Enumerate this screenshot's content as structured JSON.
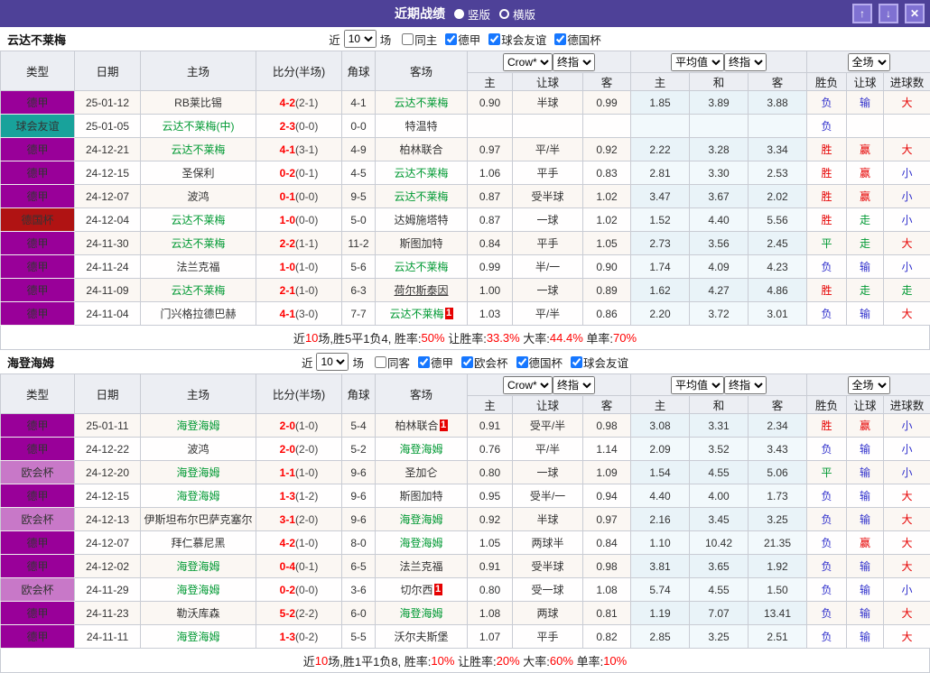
{
  "titlebar": {
    "title": "近期战绩",
    "vertical_label": "竖版",
    "horizontal_label": "横版",
    "vertical_selected": true,
    "buttons": {
      "up_icon": "↑",
      "down_icon": "↓",
      "close_icon": "✕"
    }
  },
  "labels": {
    "near": "近",
    "games": "场"
  },
  "selectors": {
    "odds_source": "Crow*",
    "final_odds": "终指",
    "average": "平均值",
    "final_odds2": "终指",
    "full_match": "全场"
  },
  "columns": {
    "type": "类型",
    "date": "日期",
    "home": "主场",
    "score": "比分(半场)",
    "corners": "角球",
    "away": "客场",
    "sub": [
      "主",
      "让球",
      "客",
      "主",
      "和",
      "客",
      "胜负",
      "让球",
      "进球数"
    ]
  },
  "colors": {
    "titlebar_bg": "#4e4198",
    "score_red": "#ff0000",
    "focus_team_green": "#009933",
    "result_red": "#e60000",
    "result_blue": "#3030cc",
    "result_green": "#009933",
    "badge_red": "#e60000",
    "type_colors": {
      "德甲": "#990099",
      "球会友谊": "#18a29b",
      "德国杯": "#b01313",
      "欧会杯": "#c878c8"
    },
    "result_map": {
      "胜": "red",
      "平": "green",
      "负": "blue",
      "赢": "red",
      "走": "green",
      "输": "blue",
      "大": "red",
      "小": "blue"
    }
  },
  "teams": [
    {
      "name": "云达不莱梅",
      "filter": {
        "count": "10",
        "same": {
          "label": "同主",
          "checked": false
        },
        "competitions": [
          {
            "label": "德甲",
            "checked": true
          },
          {
            "label": "球会友谊",
            "checked": true
          },
          {
            "label": "德国杯",
            "checked": true
          }
        ]
      },
      "rows": [
        {
          "type": "德甲",
          "date": "25-01-12",
          "home": "RB莱比锡",
          "score": "4-2",
          "half": "(2-1)",
          "corners": "4-1",
          "away": "云达不莱梅",
          "away_focus": true,
          "odds": [
            "0.90",
            "半球",
            "0.99"
          ],
          "avg": [
            "1.85",
            "3.89",
            "3.88"
          ],
          "results": [
            "负",
            "输",
            "大"
          ]
        },
        {
          "type": "球会友谊",
          "date": "25-01-05",
          "home": "云达不莱梅(中)",
          "home_focus": true,
          "score": "2-3",
          "half": "(0-0)",
          "corners": "0-0",
          "away": "特温特",
          "odds": [
            "",
            "",
            ""
          ],
          "avg": [
            "",
            "",
            ""
          ],
          "results": [
            "负",
            "",
            ""
          ]
        },
        {
          "type": "德甲",
          "date": "24-12-21",
          "home": "云达不莱梅",
          "home_focus": true,
          "score": "4-1",
          "half": "(3-1)",
          "corners": "4-9",
          "away": "柏林联合",
          "odds": [
            "0.97",
            "平/半",
            "0.92"
          ],
          "avg": [
            "2.22",
            "3.28",
            "3.34"
          ],
          "results": [
            "胜",
            "赢",
            "大"
          ]
        },
        {
          "type": "德甲",
          "date": "24-12-15",
          "home": "圣保利",
          "score": "0-2",
          "half": "(0-1)",
          "corners": "4-5",
          "away": "云达不莱梅",
          "away_focus": true,
          "odds": [
            "1.06",
            "平手",
            "0.83"
          ],
          "avg": [
            "2.81",
            "3.30",
            "2.53"
          ],
          "results": [
            "胜",
            "赢",
            "小"
          ]
        },
        {
          "type": "德甲",
          "date": "24-12-07",
          "home": "波鸿",
          "score": "0-1",
          "half": "(0-0)",
          "corners": "9-5",
          "away": "云达不莱梅",
          "away_focus": true,
          "odds": [
            "0.87",
            "受半球",
            "1.02"
          ],
          "avg": [
            "3.47",
            "3.67",
            "2.02"
          ],
          "results": [
            "胜",
            "赢",
            "小"
          ]
        },
        {
          "type": "德国杯",
          "date": "24-12-04",
          "home": "云达不莱梅",
          "home_focus": true,
          "score": "1-0",
          "half": "(0-0)",
          "corners": "5-0",
          "away": "达姆施塔特",
          "odds": [
            "0.87",
            "一球",
            "1.02"
          ],
          "avg": [
            "1.52",
            "4.40",
            "5.56"
          ],
          "results": [
            "胜",
            "走",
            "小"
          ]
        },
        {
          "type": "德甲",
          "date": "24-11-30",
          "home": "云达不莱梅",
          "home_focus": true,
          "score": "2-2",
          "half": "(1-1)",
          "corners": "11-2",
          "away": "斯图加特",
          "odds": [
            "0.84",
            "平手",
            "1.05"
          ],
          "avg": [
            "2.73",
            "3.56",
            "2.45"
          ],
          "results": [
            "平",
            "走",
            "大"
          ]
        },
        {
          "type": "德甲",
          "date": "24-11-24",
          "home": "法兰克福",
          "score": "1-0",
          "half": "(1-0)",
          "corners": "5-6",
          "away": "云达不莱梅",
          "away_focus": true,
          "odds": [
            "0.99",
            "半/一",
            "0.90"
          ],
          "avg": [
            "1.74",
            "4.09",
            "4.23"
          ],
          "results": [
            "负",
            "输",
            "小"
          ]
        },
        {
          "type": "德甲",
          "date": "24-11-09",
          "home": "云达不莱梅",
          "home_focus": true,
          "score": "2-1",
          "half": "(1-0)",
          "corners": "6-3",
          "away": "荷尔斯泰因",
          "away_underline": true,
          "odds": [
            "1.00",
            "一球",
            "0.89"
          ],
          "avg": [
            "1.62",
            "4.27",
            "4.86"
          ],
          "results": [
            "胜",
            "走",
            "走"
          ]
        },
        {
          "type": "德甲",
          "date": "24-11-04",
          "home": "门兴格拉德巴赫",
          "score": "4-1",
          "half": "(3-0)",
          "corners": "7-7",
          "away": "云达不莱梅",
          "away_focus": true,
          "away_badge": "1",
          "odds": [
            "1.03",
            "平/半",
            "0.86"
          ],
          "avg": [
            "2.20",
            "3.72",
            "3.01"
          ],
          "results": [
            "负",
            "输",
            "大"
          ]
        }
      ],
      "summary": [
        {
          "t": "近"
        },
        {
          "t": "10",
          "r": true
        },
        {
          "t": "场,胜5平1负4, 胜率:"
        },
        {
          "t": "50%",
          "r": true
        },
        {
          "t": " 让胜率:"
        },
        {
          "t": "33.3%",
          "r": true
        },
        {
          "t": " 大率:"
        },
        {
          "t": "44.4%",
          "r": true
        },
        {
          "t": " 单率:"
        },
        {
          "t": "70%",
          "r": true
        }
      ]
    },
    {
      "name": "海登海姆",
      "filter": {
        "count": "10",
        "same": {
          "label": "同客",
          "checked": false
        },
        "competitions": [
          {
            "label": "德甲",
            "checked": true
          },
          {
            "label": "欧会杯",
            "checked": true
          },
          {
            "label": "德国杯",
            "checked": true
          },
          {
            "label": "球会友谊",
            "checked": true
          }
        ]
      },
      "rows": [
        {
          "type": "德甲",
          "date": "25-01-11",
          "home": "海登海姆",
          "home_focus": true,
          "score": "2-0",
          "half": "(1-0)",
          "corners": "5-4",
          "away": "柏林联合",
          "away_badge": "1",
          "odds": [
            "0.91",
            "受平/半",
            "0.98"
          ],
          "avg": [
            "3.08",
            "3.31",
            "2.34"
          ],
          "results": [
            "胜",
            "赢",
            "小"
          ]
        },
        {
          "type": "德甲",
          "date": "24-12-22",
          "home": "波鸿",
          "score": "2-0",
          "half": "(2-0)",
          "corners": "5-2",
          "away": "海登海姆",
          "away_focus": true,
          "odds": [
            "0.76",
            "平/半",
            "1.14"
          ],
          "avg": [
            "2.09",
            "3.52",
            "3.43"
          ],
          "results": [
            "负",
            "输",
            "小"
          ]
        },
        {
          "type": "欧会杯",
          "date": "24-12-20",
          "home": "海登海姆",
          "home_focus": true,
          "score": "1-1",
          "half": "(1-0)",
          "corners": "9-6",
          "away": "圣加仑",
          "odds": [
            "0.80",
            "一球",
            "1.09"
          ],
          "avg": [
            "1.54",
            "4.55",
            "5.06"
          ],
          "results": [
            "平",
            "输",
            "小"
          ]
        },
        {
          "type": "德甲",
          "date": "24-12-15",
          "home": "海登海姆",
          "home_focus": true,
          "score": "1-3",
          "half": "(1-2)",
          "corners": "9-6",
          "away": "斯图加特",
          "odds": [
            "0.95",
            "受半/一",
            "0.94"
          ],
          "avg": [
            "4.40",
            "4.00",
            "1.73"
          ],
          "results": [
            "负",
            "输",
            "大"
          ]
        },
        {
          "type": "欧会杯",
          "date": "24-12-13",
          "home": "伊斯坦布尔巴萨克塞尔",
          "score": "3-1",
          "half": "(2-0)",
          "corners": "9-6",
          "away": "海登海姆",
          "away_focus": true,
          "odds": [
            "0.92",
            "半球",
            "0.97"
          ],
          "avg": [
            "2.16",
            "3.45",
            "3.25"
          ],
          "results": [
            "负",
            "输",
            "大"
          ]
        },
        {
          "type": "德甲",
          "date": "24-12-07",
          "home": "拜仁慕尼黑",
          "score": "4-2",
          "half": "(1-0)",
          "corners": "8-0",
          "away": "海登海姆",
          "away_focus": true,
          "odds": [
            "1.05",
            "两球半",
            "0.84"
          ],
          "avg": [
            "1.10",
            "10.42",
            "21.35"
          ],
          "results": [
            "负",
            "赢",
            "大"
          ]
        },
        {
          "type": "德甲",
          "date": "24-12-02",
          "home": "海登海姆",
          "home_focus": true,
          "score": "0-4",
          "half": "(0-1)",
          "corners": "6-5",
          "away": "法兰克福",
          "odds": [
            "0.91",
            "受半球",
            "0.98"
          ],
          "avg": [
            "3.81",
            "3.65",
            "1.92"
          ],
          "results": [
            "负",
            "输",
            "大"
          ]
        },
        {
          "type": "欧会杯",
          "date": "24-11-29",
          "home": "海登海姆",
          "home_focus": true,
          "score": "0-2",
          "half": "(0-0)",
          "corners": "3-6",
          "away": "切尔西",
          "away_badge": "1",
          "odds": [
            "0.80",
            "受一球",
            "1.08"
          ],
          "avg": [
            "5.74",
            "4.55",
            "1.50"
          ],
          "results": [
            "负",
            "输",
            "小"
          ]
        },
        {
          "type": "德甲",
          "date": "24-11-23",
          "home": "勒沃库森",
          "score": "5-2",
          "half": "(2-2)",
          "corners": "6-0",
          "away": "海登海姆",
          "away_focus": true,
          "odds": [
            "1.08",
            "两球",
            "0.81"
          ],
          "avg": [
            "1.19",
            "7.07",
            "13.41"
          ],
          "results": [
            "负",
            "输",
            "大"
          ]
        },
        {
          "type": "德甲",
          "date": "24-11-11",
          "home": "海登海姆",
          "home_focus": true,
          "score": "1-3",
          "half": "(0-2)",
          "corners": "5-5",
          "away": "沃尔夫斯堡",
          "odds": [
            "1.07",
            "平手",
            "0.82"
          ],
          "avg": [
            "2.85",
            "3.25",
            "2.51"
          ],
          "results": [
            "负",
            "输",
            "大"
          ]
        }
      ],
      "summary": [
        {
          "t": "近"
        },
        {
          "t": "10",
          "r": true
        },
        {
          "t": "场,胜1平1负8, 胜率:"
        },
        {
          "t": "10%",
          "r": true
        },
        {
          "t": " 让胜率:"
        },
        {
          "t": "20%",
          "r": true
        },
        {
          "t": " 大率:"
        },
        {
          "t": "60%",
          "r": true
        },
        {
          "t": " 单率:"
        },
        {
          "t": "10%",
          "r": true
        }
      ]
    }
  ]
}
